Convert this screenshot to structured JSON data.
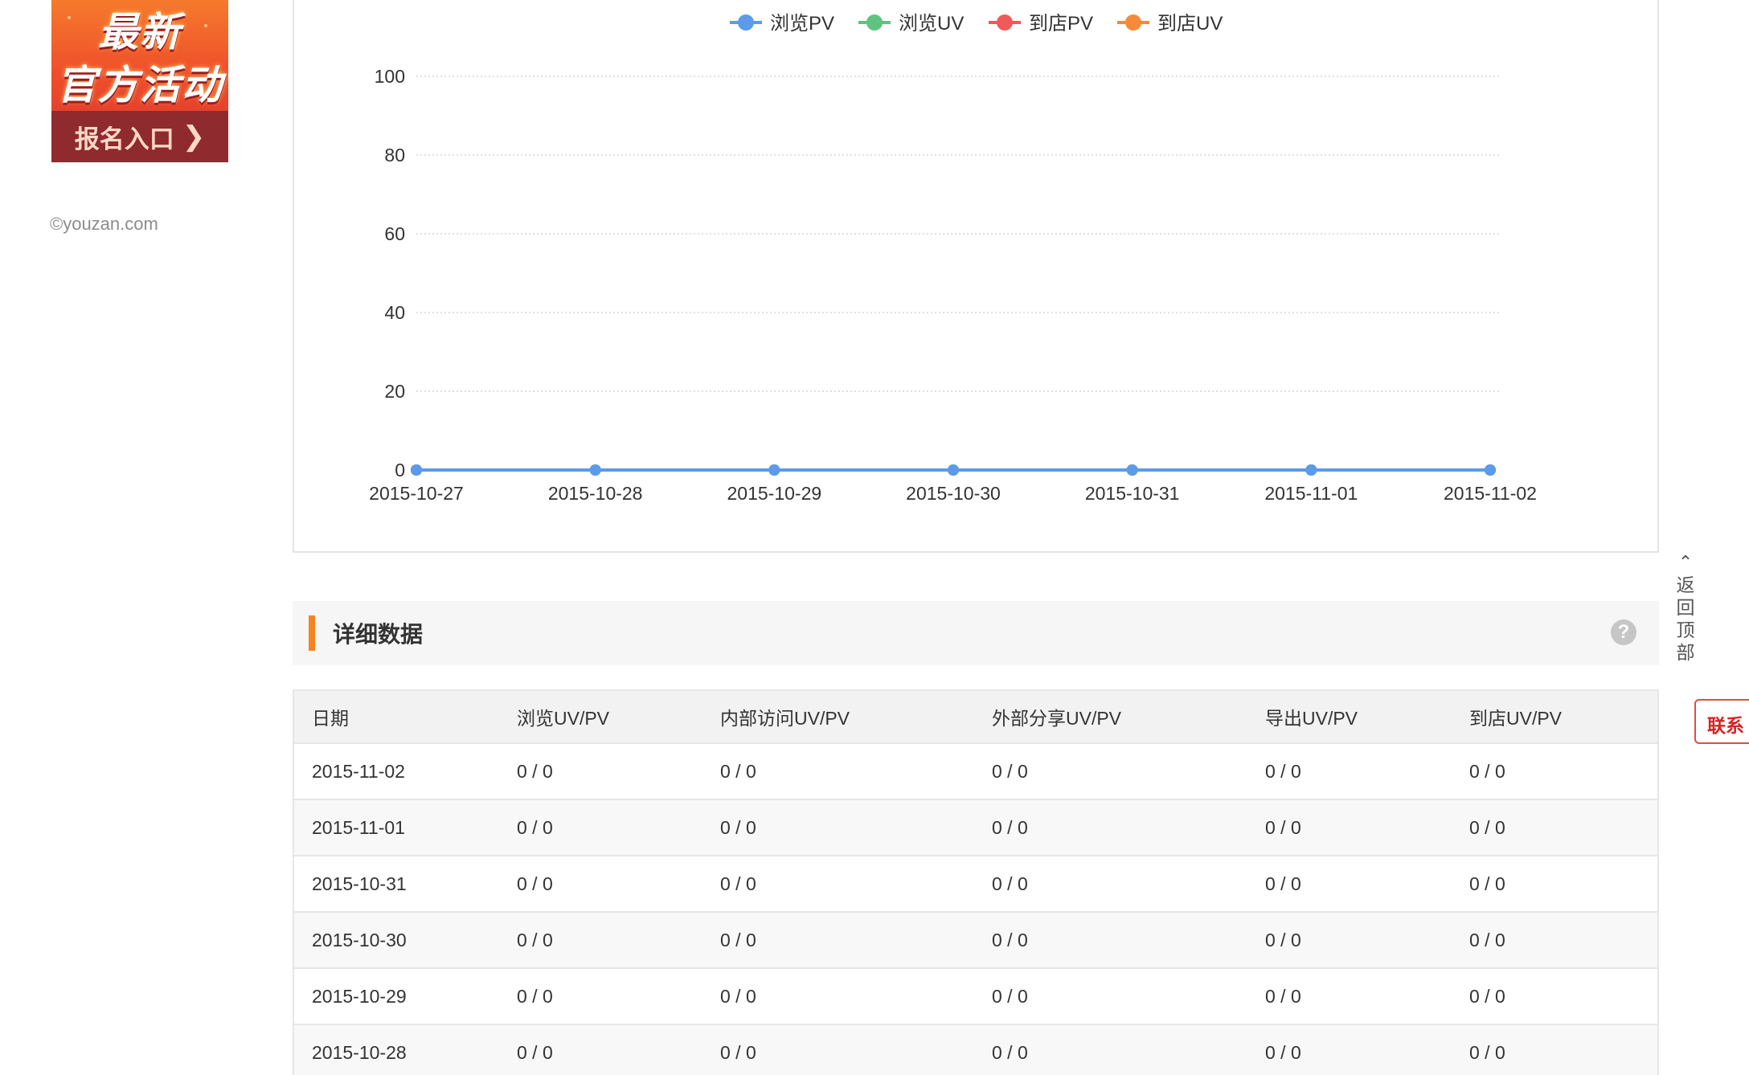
{
  "promo": {
    "line1": "最新",
    "line2": "官方活动",
    "cta": "报名入口",
    "cta_icon": "chevron-right-icon"
  },
  "copyright": "©youzan.com",
  "chart_data": {
    "type": "line",
    "categories": [
      "2015-10-27",
      "2015-10-28",
      "2015-10-29",
      "2015-10-30",
      "2015-10-31",
      "2015-11-01",
      "2015-11-02"
    ],
    "series": [
      {
        "name": "浏览PV",
        "color": "#5b9bea",
        "values": [
          0,
          0,
          0,
          0,
          0,
          0,
          0
        ]
      },
      {
        "name": "浏览UV",
        "color": "#5ec37e",
        "values": [
          0,
          0,
          0,
          0,
          0,
          0,
          0
        ]
      },
      {
        "name": "到店PV",
        "color": "#ef5a5a",
        "values": [
          0,
          0,
          0,
          0,
          0,
          0,
          0
        ]
      },
      {
        "name": "到店UV",
        "color": "#f7893a",
        "values": [
          0,
          0,
          0,
          0,
          0,
          0,
          0
        ]
      }
    ],
    "ylim": [
      0,
      100
    ],
    "yticks": [
      0,
      20,
      40,
      60,
      80,
      100
    ],
    "grid": true,
    "legend": "top-center"
  },
  "detail": {
    "title": "详细数据",
    "help": "?"
  },
  "table": {
    "headers": [
      "日期",
      "浏览UV/PV",
      "内部访问UV/PV",
      "外部分享UV/PV",
      "导出UV/PV",
      "到店UV/PV"
    ],
    "rows": [
      [
        "2015-11-02",
        "0 / 0",
        "0 / 0",
        "0 / 0",
        "0 / 0",
        "0 / 0"
      ],
      [
        "2015-11-01",
        "0 / 0",
        "0 / 0",
        "0 / 0",
        "0 / 0",
        "0 / 0"
      ],
      [
        "2015-10-31",
        "0 / 0",
        "0 / 0",
        "0 / 0",
        "0 / 0",
        "0 / 0"
      ],
      [
        "2015-10-30",
        "0 / 0",
        "0 / 0",
        "0 / 0",
        "0 / 0",
        "0 / 0"
      ],
      [
        "2015-10-29",
        "0 / 0",
        "0 / 0",
        "0 / 0",
        "0 / 0",
        "0 / 0"
      ],
      [
        "2015-10-28",
        "0 / 0",
        "0 / 0",
        "0 / 0",
        "0 / 0",
        "0 / 0"
      ]
    ]
  },
  "back_top": {
    "label": "返回顶部",
    "icon": "chevron-up-icon"
  },
  "contact": {
    "label": "联系"
  }
}
